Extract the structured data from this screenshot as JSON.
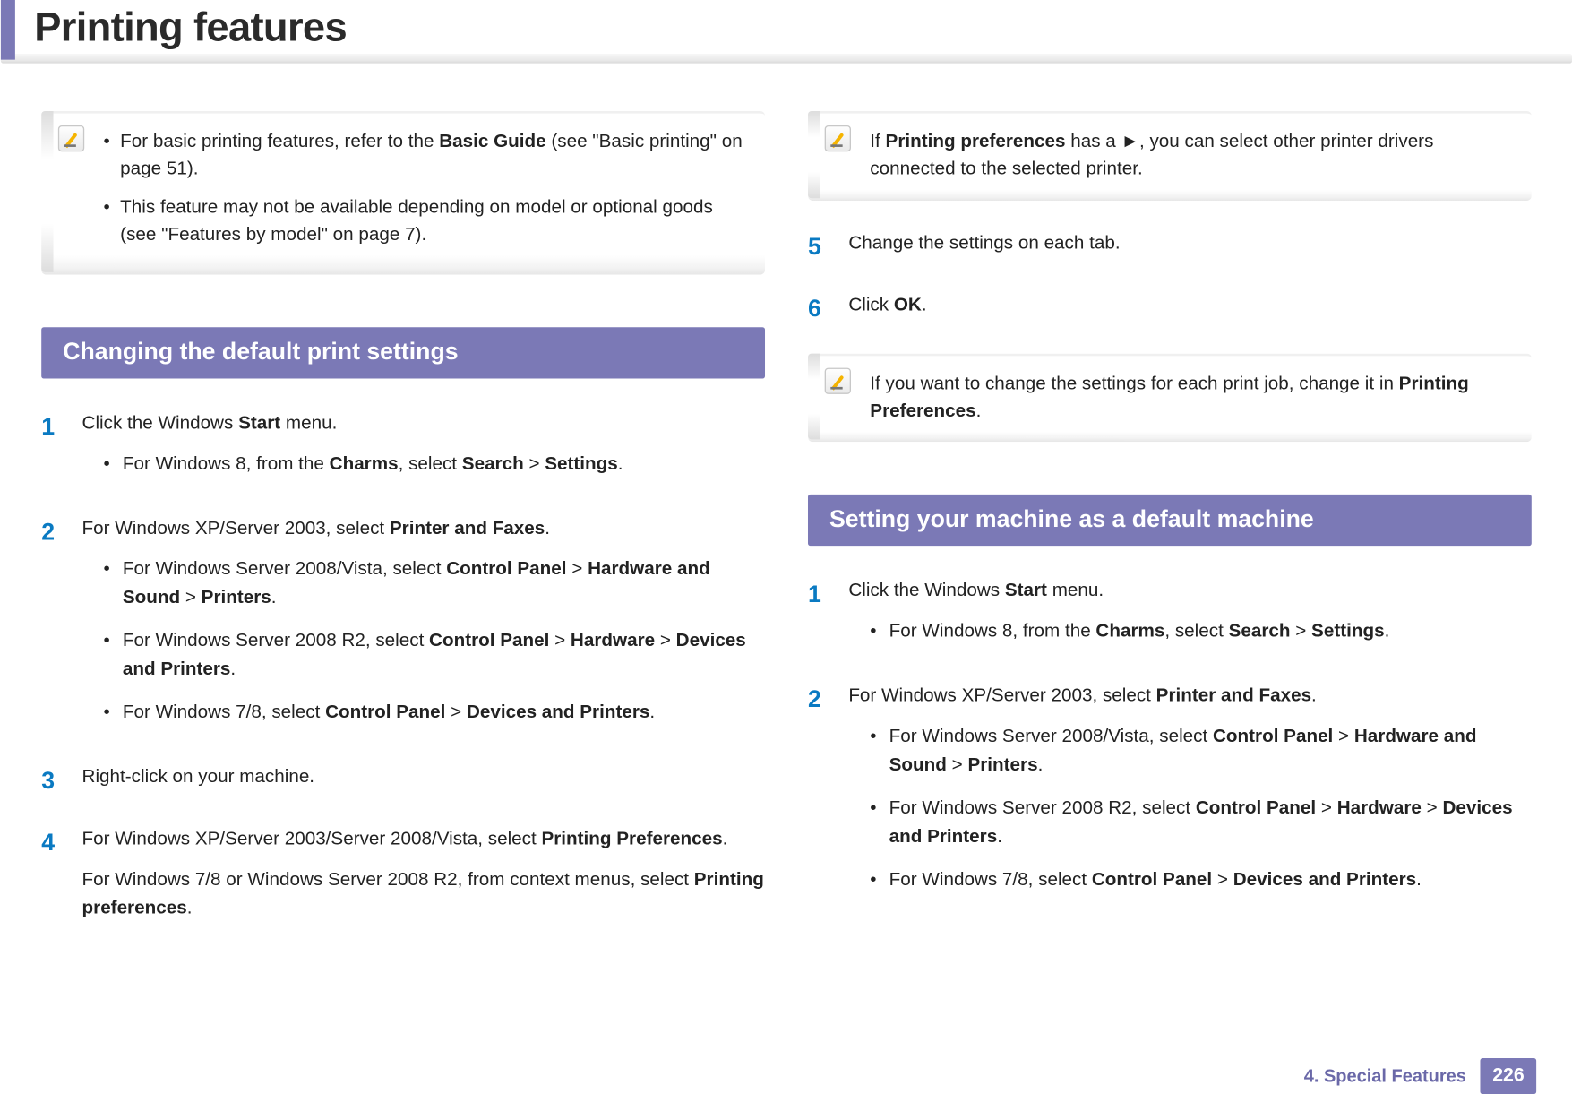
{
  "title": "Printing features",
  "footer": {
    "chapter": "4.  Special Features",
    "page": "226"
  },
  "col1": {
    "note1": {
      "b1a": "For basic printing features, refer to the ",
      "b1b": "Basic Guide",
      "b1c": " (see \"Basic printing\" on page 51).",
      "b2": "This feature may not be available depending on model or optional goods (see \"Features by model\" on page 7)."
    },
    "section1": "Changing the default print settings",
    "s1": {
      "p1a": "Click the Windows ",
      "p1b": "Start",
      "p1c": " menu.",
      "sub1a": "For Windows 8, from the ",
      "sub1b": "Charms",
      "sub1c": ", select ",
      "sub1d": "Search",
      "sub1e": " > ",
      "sub1f": "Settings",
      "sub1g": "."
    },
    "s2": {
      "p1a": "For Windows XP/Server 2003, select ",
      "p1b": "Printer and Faxes",
      "p1c": ".",
      "sub1a": "For Windows Server 2008/Vista, select ",
      "sub1b": "Control Panel",
      "sub1c": " > ",
      "sub1d": "Hardware and Sound",
      "sub1e": " > ",
      "sub1f": "Printers",
      "sub1g": ".",
      "sub2a": "For Windows Server 2008 R2, select ",
      "sub2b": "Control Panel",
      "sub2c": " > ",
      "sub2d": "Hardware",
      "sub2e": " > ",
      "sub2f": "Devices and Printers",
      "sub2g": ".",
      "sub3a": "For Windows 7/8, select ",
      "sub3b": "Control Panel",
      "sub3c": " > ",
      "sub3d": "Devices and Printers",
      "sub3e": "."
    },
    "s3": {
      "p1": "Right-click on your machine."
    },
    "s4": {
      "p1a": "For Windows XP/Server 2003/Server 2008/Vista, select ",
      "p1b": "Printing Preferences",
      "p1c": ".",
      "p2a": "For Windows 7/8 or Windows Server 2008 R2, from context menus, select ",
      "p2b": "Printing preferences",
      "p2c": "."
    }
  },
  "col2": {
    "note2a": "If ",
    "note2b": "Printing preferences",
    "note2c": " has a ►, you can select other printer drivers connected to the selected printer.",
    "s5": {
      "p1": "Change the settings on each tab."
    },
    "s6": {
      "p1a": "Click ",
      "p1b": "OK",
      "p1c": "."
    },
    "note3a": "If you want to change the settings for each print job, change it in ",
    "note3b": "Printing Preferences",
    "note3c": ".",
    "section2": "Setting your machine as a default machine",
    "d1": {
      "p1a": "Click the Windows ",
      "p1b": "Start",
      "p1c": " menu.",
      "sub1a": "For Windows 8, from the ",
      "sub1b": "Charms",
      "sub1c": ", select ",
      "sub1d": "Search",
      "sub1e": " > ",
      "sub1f": "Settings",
      "sub1g": "."
    },
    "d2": {
      "p1a": "For Windows XP/Server 2003, select ",
      "p1b": "Printer and Faxes",
      "p1c": ".",
      "sub1a": "For Windows Server 2008/Vista, select ",
      "sub1b": "Control Panel",
      "sub1c": " > ",
      "sub1d": "Hardware and Sound",
      "sub1e": " > ",
      "sub1f": "Printers",
      "sub1g": ".",
      "sub2a": "For Windows Server 2008 R2, select ",
      "sub2b": "Control Panel",
      "sub2c": " > ",
      "sub2d": "Hardware",
      "sub2e": " > ",
      "sub2f": "Devices and Printers",
      "sub2g": ".",
      "sub3a": "For Windows 7/8, select ",
      "sub3b": "Control Panel",
      "sub3c": " > ",
      "sub3d": "Devices and Printers",
      "sub3e": "."
    }
  },
  "nums": {
    "n1": "1",
    "n2": "2",
    "n3": "3",
    "n4": "4",
    "n5": "5",
    "n6": "6"
  }
}
